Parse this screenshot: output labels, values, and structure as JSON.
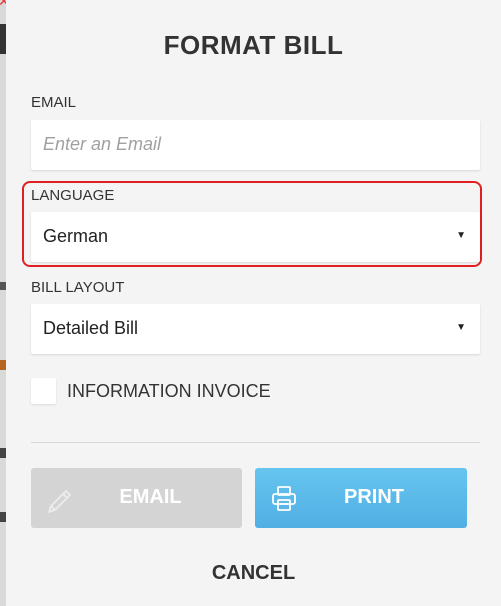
{
  "dialog": {
    "title": "FORMAT BILL"
  },
  "email": {
    "label": "EMAIL",
    "placeholder": "Enter an Email",
    "value": ""
  },
  "language": {
    "label": "LANGUAGE",
    "selected": "German"
  },
  "bill_layout": {
    "label": "BILL LAYOUT",
    "selected": "Detailed Bill"
  },
  "information_invoice": {
    "label": "INFORMATION INVOICE",
    "checked": false
  },
  "buttons": {
    "email_label": "EMAIL",
    "email_icon": "email-send-icon",
    "print_label": "PRINT",
    "print_icon": "printer-icon",
    "cancel_label": "CANCEL"
  },
  "colors": {
    "print_button": "#5ab9e9",
    "email_button_disabled": "#d4d4d4",
    "highlight": "#e02020"
  }
}
